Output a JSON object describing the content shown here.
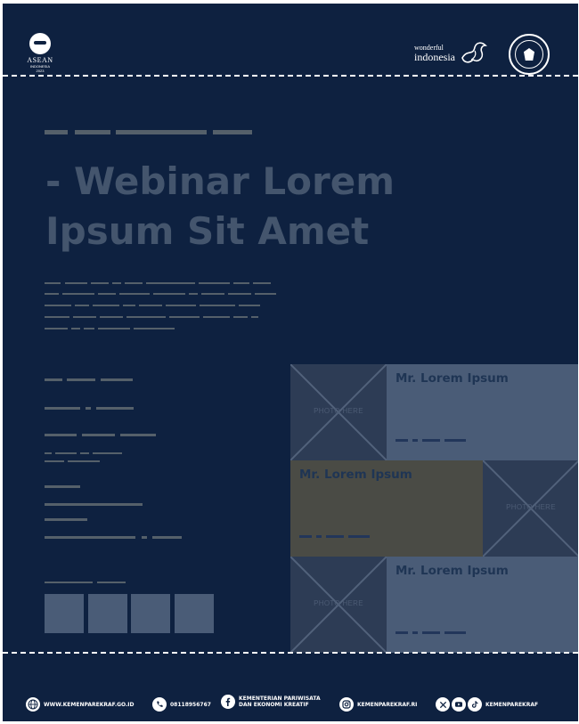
{
  "header": {
    "asean_logo": {
      "text": "ASEAN",
      "country": "INDONESIA",
      "year": "2023"
    },
    "wonderful_logo": {
      "line1": "wonderful",
      "line2": "indonesia"
    },
    "seal_icon": "garuda-seal-icon"
  },
  "main": {
    "title_line1": "- Webinar Lorem",
    "title_line2": "Ipsum Sit Amet"
  },
  "speakers": [
    {
      "name": "Mr. Lorem Ipsum",
      "photo_label": "PHOTO HERE"
    },
    {
      "name": "Mr. Lorem Ipsum",
      "photo_label": "PHOTO HERE"
    },
    {
      "name": "Mr. Lorem Ipsum",
      "photo_label": "PHOTO HERE"
    }
  ],
  "footer": {
    "website": "WWW.KEMENPAREKRAF.GO.ID",
    "phone": "08118956767",
    "facebook_line1": "KEMENTERIAN PARIWISATA",
    "facebook_line2": "DAN EKONOMI KREATIF",
    "instagram": "KEMENPAREKRAF.RI",
    "social_handle": "KEMENPAREKRAF"
  },
  "colors": {
    "background": "#0e2140",
    "placeholder": "#55606a",
    "title": "#44556d",
    "card_blue": "#4a5c77",
    "card_olive": "#4a4b45",
    "photo_bg": "#2d3c55",
    "speaker_name": "#1f3554"
  }
}
